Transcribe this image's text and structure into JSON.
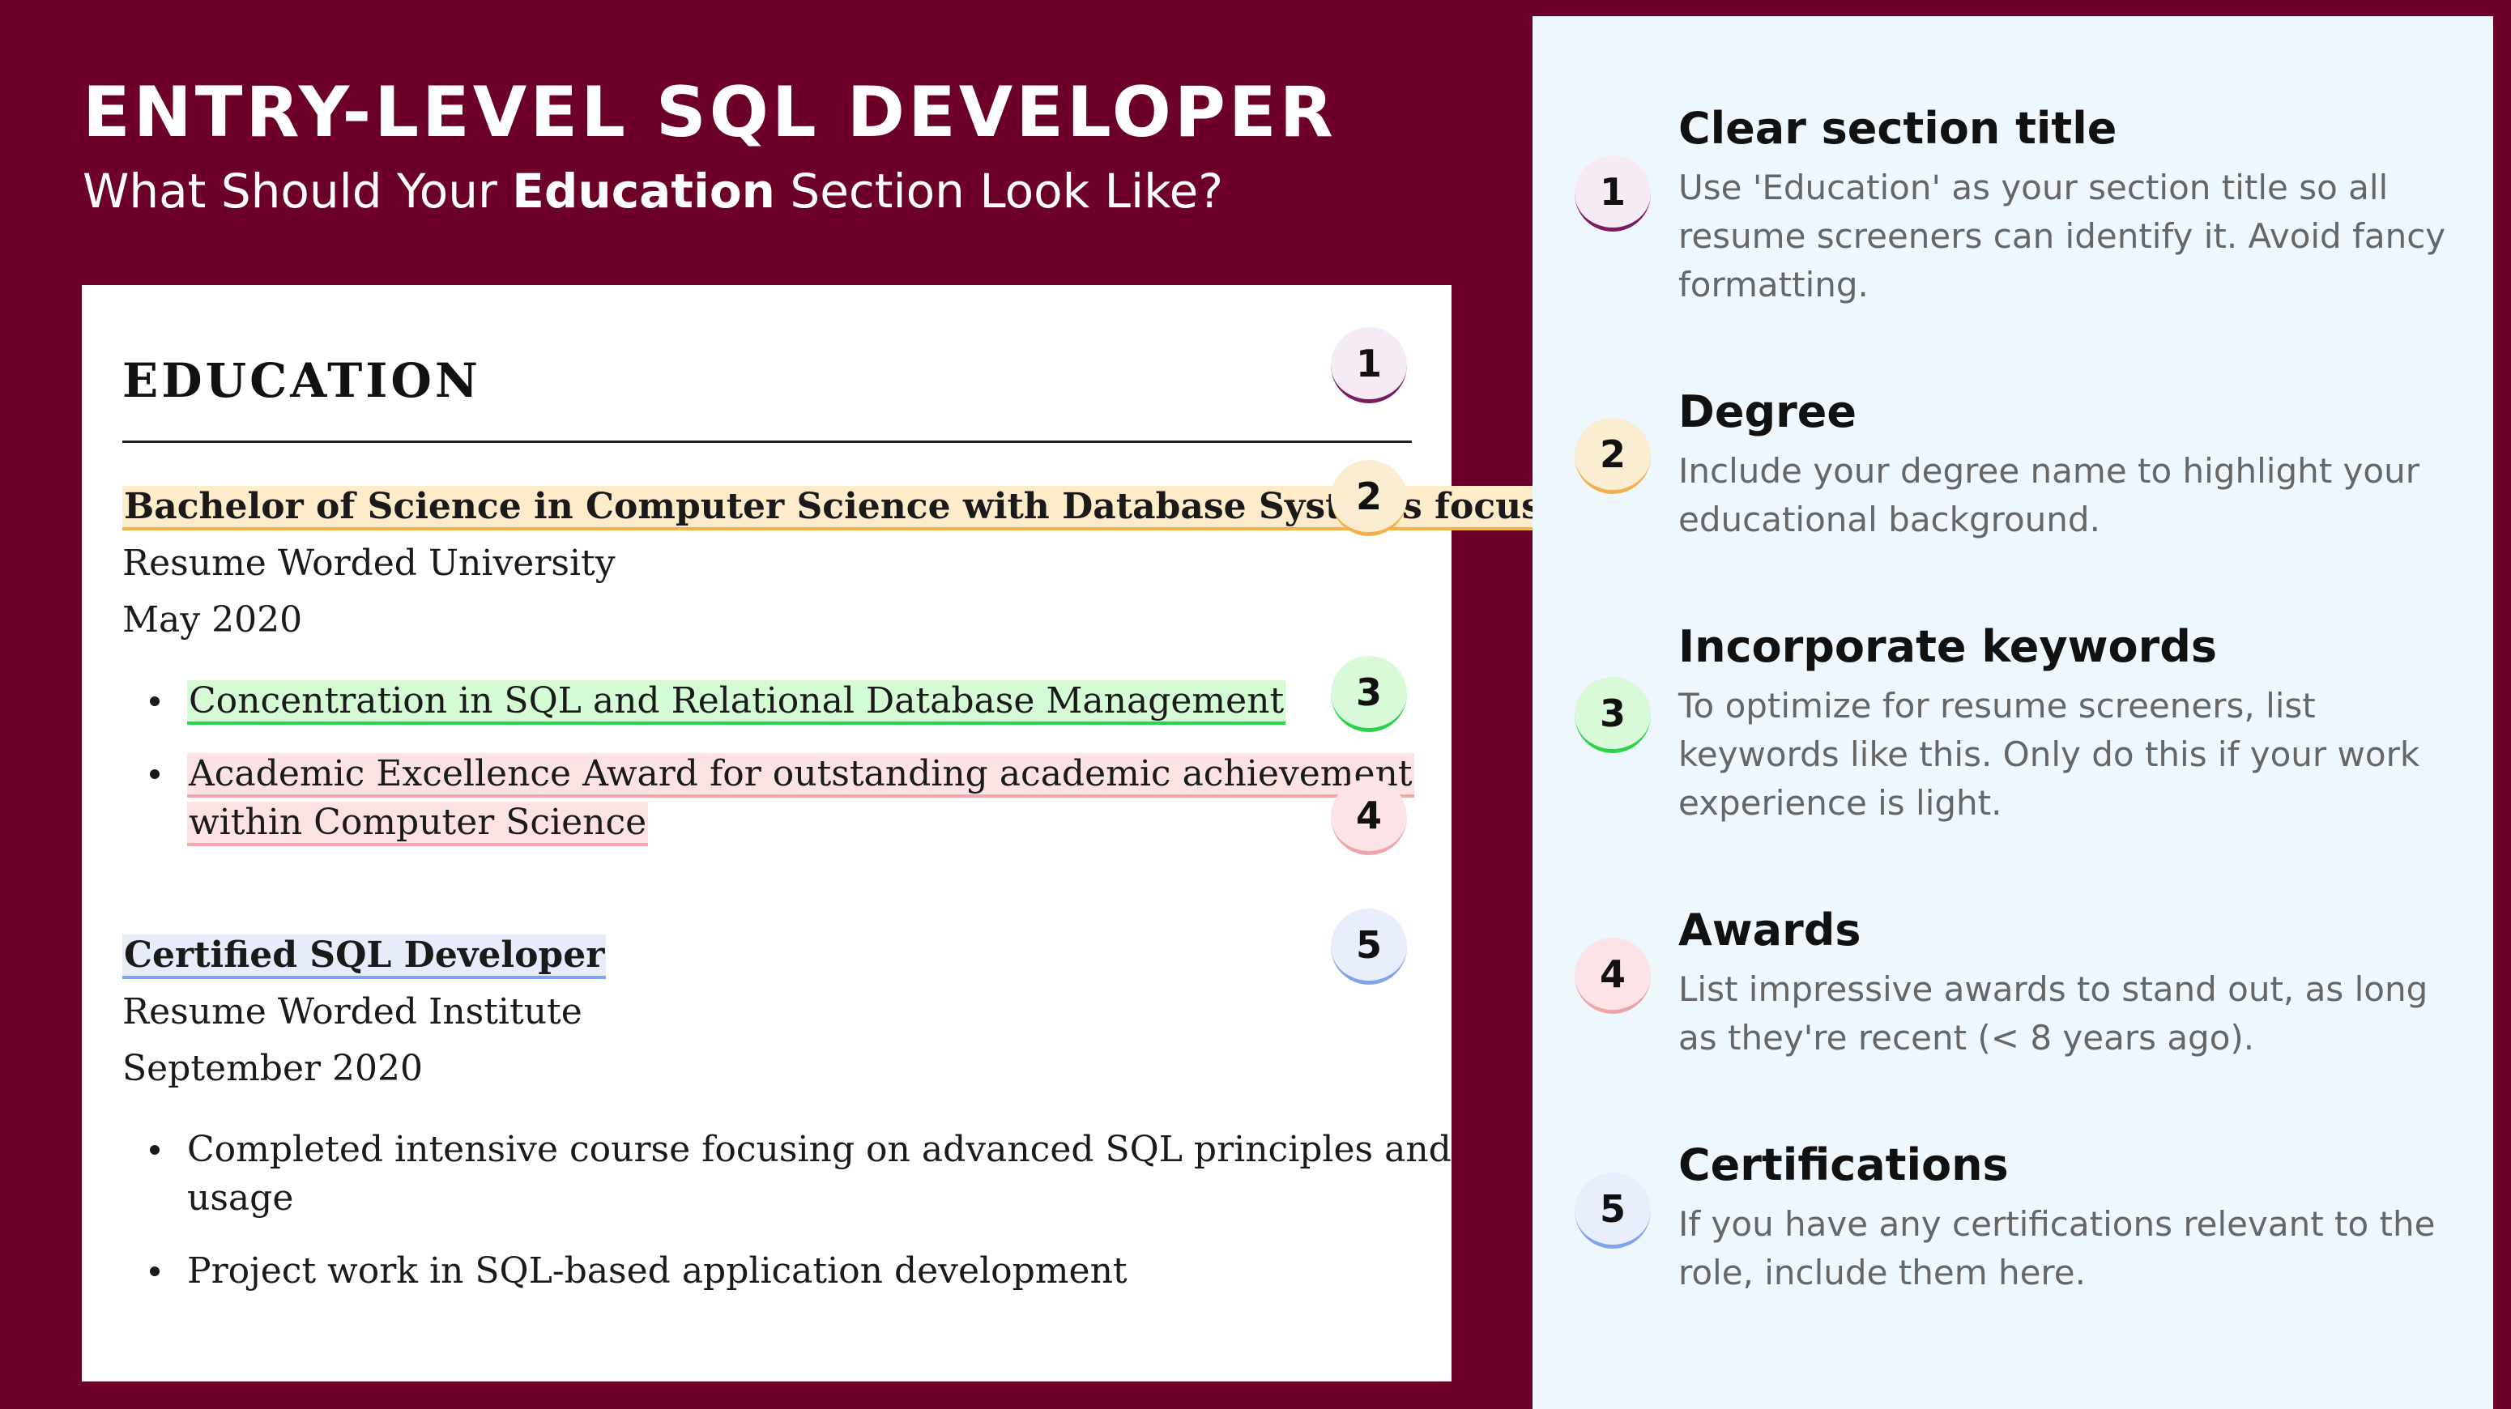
{
  "header": {
    "title": "ENTRY-LEVEL SQL DEVELOPER",
    "subtitle_pre": "What Should Your ",
    "subtitle_bold": "Education",
    "subtitle_post": " Section Look Like?"
  },
  "resume": {
    "section_title": "EDUCATION",
    "entries": [
      {
        "degree": "Bachelor of Science in Computer Science with Database Systems focus",
        "school": "Resume Worded University",
        "date": "May 2020",
        "bullets": [
          "Concentration in SQL and Relational Database Management",
          "Academic Excellence Award for outstanding academic achievement",
          "within Computer Science"
        ]
      },
      {
        "degree": "Certified SQL Developer",
        "school": "Resume Worded Institute",
        "date": "September 2020",
        "bullets": [
          "Completed intensive course focusing on advanced SQL principles and",
          "usage",
          "Project work in SQL-based application development"
        ]
      }
    ]
  },
  "markers": [
    "1",
    "2",
    "3",
    "4",
    "5"
  ],
  "tips": [
    {
      "number": "1",
      "title": "Clear section title",
      "description": "Use 'Education' as your section title so all resume screeners can identify it. Avoid fancy formatting.",
      "color": "#7a1a62"
    },
    {
      "number": "2",
      "title": "Degree",
      "description": "Include your degree name to highlight your educational background.",
      "color": "#f3b04b"
    },
    {
      "number": "3",
      "title": "Incorporate keywords",
      "description": "To optimize for resume screeners, list keywords like this. Only do this if your work experience is light.",
      "color": "#2bd34a"
    },
    {
      "number": "4",
      "title": "Awards",
      "description": "List impressive awards to stand out, as long as they're recent (< 8 years ago).",
      "color": "#f1a3aa"
    },
    {
      "number": "5",
      "title": "Certifications",
      "description": "If you have any certifications relevant to the role, include them here.",
      "color": "#7fa4ea"
    }
  ],
  "colors": {
    "background": "#6d0028",
    "panel": "#eef6fe",
    "card": "#ffffff"
  }
}
